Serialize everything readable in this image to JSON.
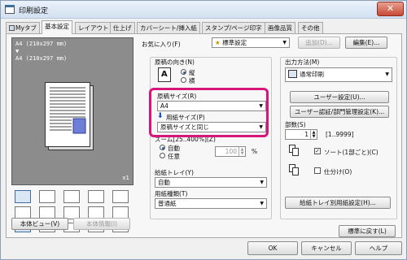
{
  "window": {
    "title": "印刷設定",
    "close_glyph": "✕"
  },
  "tabs": [
    "Myタブ",
    "基本設定",
    "レイアウト",
    "仕上げ",
    "カバーシート/挿入紙",
    "スタンプ/ページ印字",
    "画像品質",
    "その他"
  ],
  "preview": {
    "paper_info": "A4 (210x297 mm)\n▼\nA4 (210x297 mm)",
    "multiplier": "x1"
  },
  "left_buttons": {
    "preview_button": "本体ビュー(V)",
    "info_button": "本体情報(I)"
  },
  "favorite": {
    "label": "お気に入り(F)",
    "value": "標準設定",
    "add_button": "追加(D)...",
    "edit_button": "編集(E)..."
  },
  "orientation": {
    "label": "原稿の向き(N)",
    "portrait": "縦",
    "landscape": "横"
  },
  "original_size": {
    "label": "原稿サイズ(R)",
    "value": "A4"
  },
  "paper_size": {
    "label": "用紙サイズ(P)",
    "value": "原稿サイズと同じ"
  },
  "zoom": {
    "label": "ズーム[25..400%](Z)",
    "auto": "自動",
    "manual": "任意",
    "value": "100",
    "unit": "%"
  },
  "paper_tray": {
    "label": "給紙トレイ(Y)",
    "value": "自動"
  },
  "paper_type": {
    "label": "用紙種類(T)",
    "value": "普通紙"
  },
  "output": {
    "label": "出力方法(M)",
    "value": "通常印刷",
    "user_settings_button": "ユーザー設定(U)...",
    "auth_button": "ユーザー認証/部門管理設定(K)..."
  },
  "copies": {
    "label": "部数(S)",
    "value": "1",
    "range": "[1..9999]",
    "sort_label": "ソート(1部ごと)(C)",
    "group_label": "仕分け(O)"
  },
  "tray_settings_button": "給紙トレイ別用紙設定(H)...",
  "restore_button": "標準に戻す(L)",
  "footer": {
    "ok": "OK",
    "cancel": "キャンセル",
    "help": "ヘルプ"
  },
  "colors": {
    "highlight": "#d6157d",
    "accent_blue": "#2a5a9a"
  }
}
